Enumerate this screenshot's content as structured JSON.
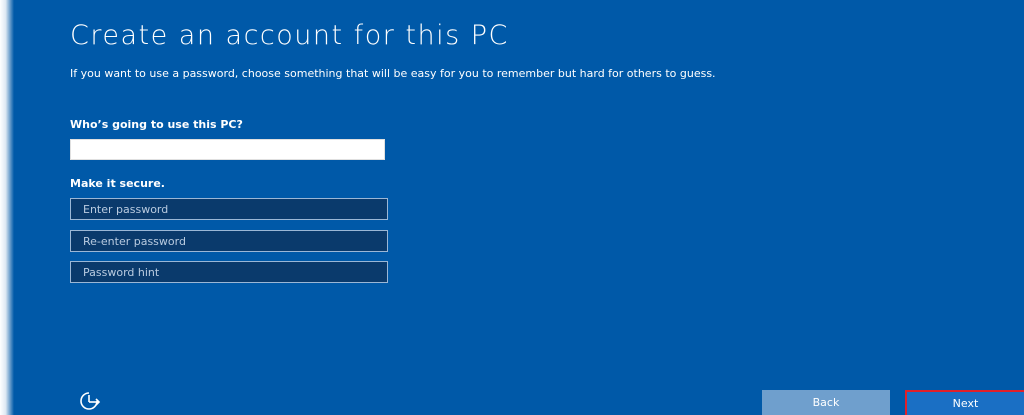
{
  "page": {
    "title": "Create an account for this PC",
    "description": "If you want to use a password, choose something that will be easy for you to remember but hard for others to guess."
  },
  "form": {
    "who_label": "Who’s going to use this PC?",
    "username_value": "",
    "secure_label": "Make it secure.",
    "password_placeholder": "Enter password",
    "reenter_placeholder": "Re-enter password",
    "hint_placeholder": "Password hint"
  },
  "footer": {
    "ease_of_access_icon": "ease-of-access-icon",
    "back_label": "Back",
    "next_label": "Next"
  },
  "colors": {
    "background": "#0059a8",
    "input_dark": "#0a3a6c",
    "back_button": "#6f9fcd",
    "next_button": "#1a6fc4",
    "highlight": "#e0202a"
  }
}
